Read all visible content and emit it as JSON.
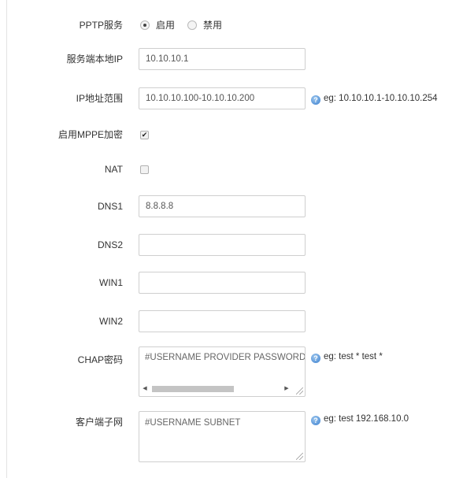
{
  "form": {
    "pptp_service": {
      "label": "PPTP服务",
      "options": [
        {
          "label": "启用",
          "checked": true
        },
        {
          "label": "禁用",
          "checked": false
        }
      ]
    },
    "server_local_ip": {
      "label": "服务端本地IP",
      "value": "10.10.10.1"
    },
    "ip_range": {
      "label": "IP地址范围",
      "value": "10.10.10.100-10.10.10.200",
      "help": "eg: 10.10.10.1-10.10.10.254"
    },
    "mppe": {
      "label": "启用MPPE加密",
      "checked": true
    },
    "nat": {
      "label": "NAT",
      "checked": false
    },
    "dns1": {
      "label": "DNS1",
      "value": "8.8.8.8"
    },
    "dns2": {
      "label": "DNS2",
      "value": ""
    },
    "win1": {
      "label": "WIN1",
      "value": ""
    },
    "win2": {
      "label": "WIN2",
      "value": ""
    },
    "chap": {
      "label": "CHAP密码",
      "value": "#USERNAME  PROVIDER  PASSWORD  IPADDRESS",
      "help": "eg: test * test *"
    },
    "client_subnet": {
      "label": "客户端子网",
      "value": "#USERNAME SUBNET",
      "help": "eg: test 192.168.10.0"
    }
  },
  "icons": {
    "help": "help-icon",
    "checkmark": "✔"
  }
}
